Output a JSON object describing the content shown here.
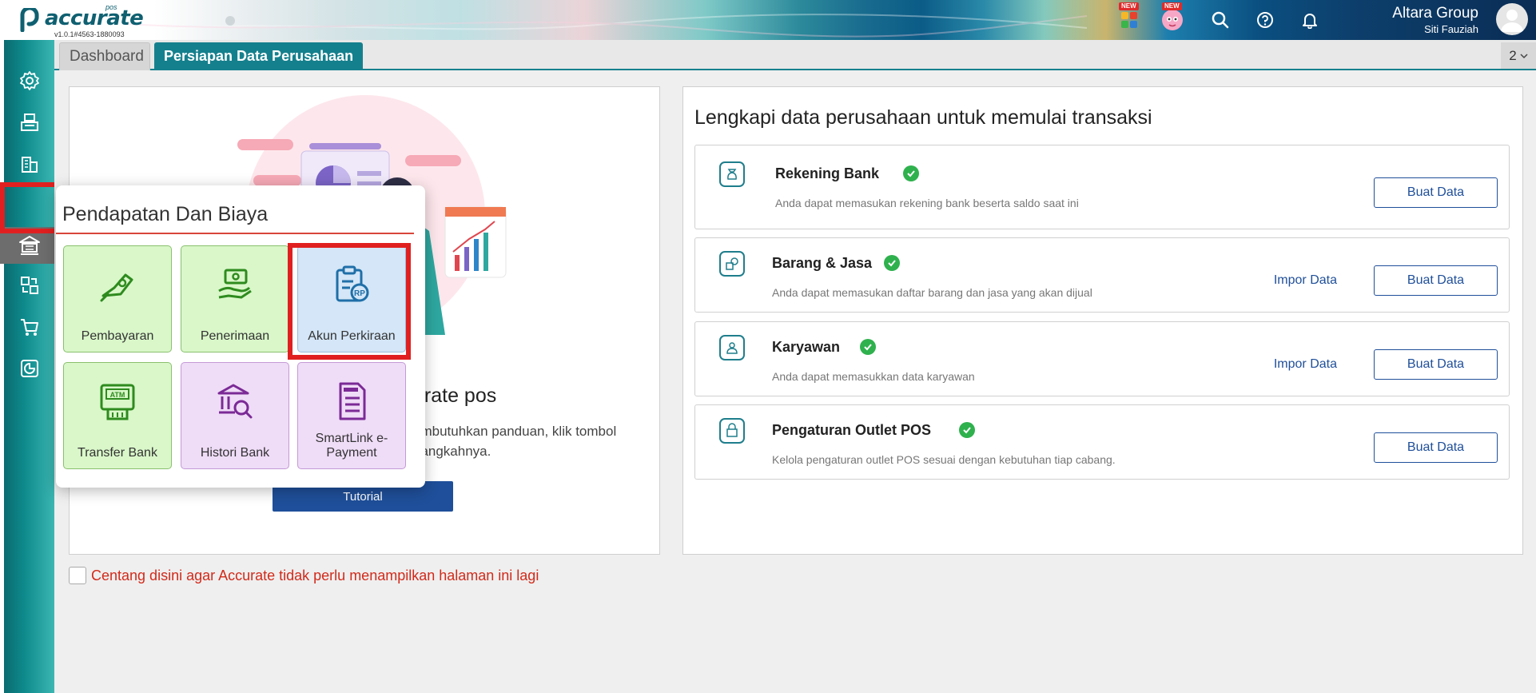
{
  "app": {
    "logo_text": "accurate",
    "logo_sub": "pos",
    "version": "v1.0.1#4563-1880093"
  },
  "header": {
    "company": "Altara Group",
    "user": "Siti Fauziah",
    "new_badge": "NEW",
    "icons": [
      "apps-icon",
      "assistant-icon",
      "search-icon",
      "help-icon",
      "bell-icon"
    ]
  },
  "tabs": {
    "dashboard": "Dashboard",
    "setup": "Persiapan Data Perusahaan",
    "count": "2"
  },
  "left_panel": {
    "heading_partial": "urate pos",
    "body_partial": "embutuhkan panduan, klik tombol -langkahnya.",
    "body_line1": "embutuhkan panduan, klik tombol",
    "body_line2": "-langkahnya.",
    "tutorial_label": "Tutorial"
  },
  "right_panel": {
    "title": "Lengkapi data perusahaan untuk memulai transaksi",
    "cards": [
      {
        "title": "Rekening Bank",
        "desc": "Anda dapat memasukan rekening bank beserta saldo saat ini",
        "buat": "Buat Data",
        "impor": ""
      },
      {
        "title": "Barang & Jasa",
        "desc": "Anda dapat memasukan daftar barang dan jasa yang akan dijual",
        "buat": "Buat Data",
        "impor": "Impor Data"
      },
      {
        "title": "Karyawan",
        "desc": "Anda dapat memasukkan data karyawan",
        "buat": "Buat Data",
        "impor": "Impor Data"
      },
      {
        "title": "Pengaturan Outlet POS",
        "desc": "Kelola pengaturan outlet POS sesuai dengan kebutuhan tiap cabang.",
        "buat": "Buat Data",
        "impor": ""
      }
    ]
  },
  "checkbox_label": "Centang disini agar Accurate tidak perlu menampilkan halaman ini lagi",
  "popup": {
    "title": "Pendapatan Dan Biaya",
    "tiles": [
      {
        "label": "Pembayaran",
        "icon": "payment-hand-icon"
      },
      {
        "label": "Penerimaan",
        "icon": "receive-money-icon"
      },
      {
        "label": "Akun Perkiraan",
        "icon": "account-clipboard-icon"
      },
      {
        "label": "Transfer Bank",
        "icon": "atm-icon"
      },
      {
        "label": "Histori Bank",
        "icon": "bank-search-icon"
      },
      {
        "label": "SmartLink e-Payment",
        "icon": "epayment-doc-icon"
      }
    ]
  },
  "colors": {
    "teal": "#15808d",
    "navy": "#1f4f9a",
    "highlight_red": "#e02020",
    "check_green": "#2fb14e"
  }
}
